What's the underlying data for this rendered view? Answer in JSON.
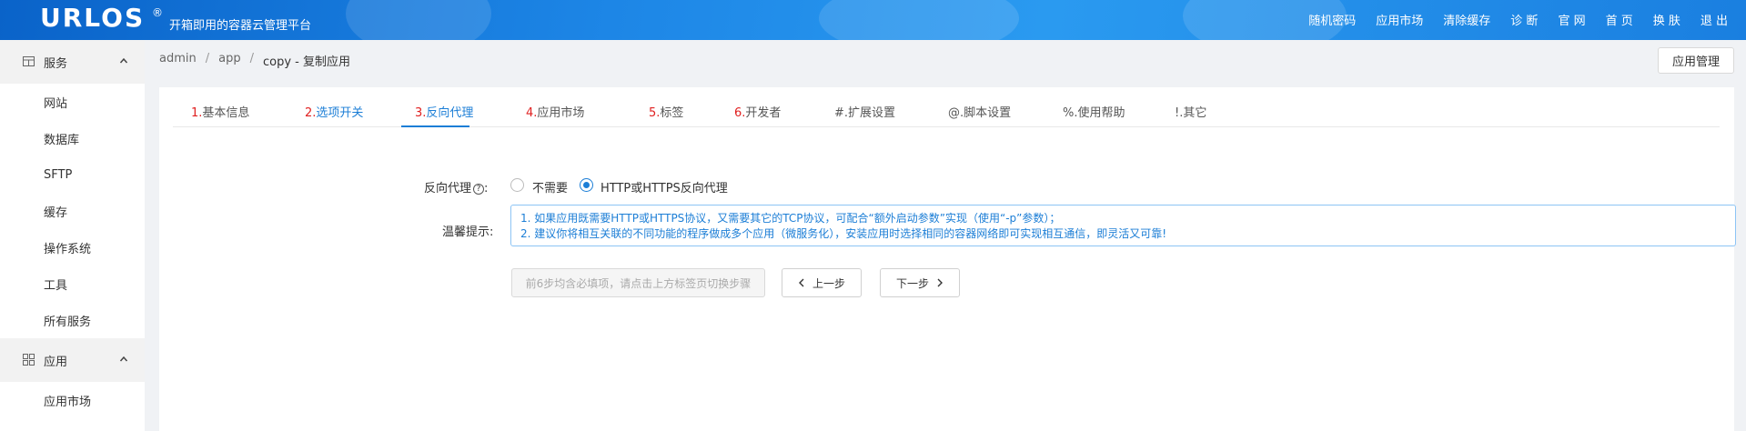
{
  "header": {
    "logo": "URLOS",
    "reg": "®",
    "slogan": "开箱即用的容器云管理平台",
    "nav": [
      "随机密码",
      "应用市场",
      "清除缓存",
      "诊 断",
      "官 网",
      "首 页",
      "换 肤",
      "退 出"
    ]
  },
  "sidebar": {
    "group1": "服务",
    "items1": [
      "网站",
      "数据库",
      "SFTP",
      "缓存",
      "操作系统",
      "工具",
      "所有服务"
    ],
    "group2": "应用",
    "items2": [
      "应用市场"
    ]
  },
  "breadcrumb": [
    "admin",
    "app",
    "copy - 复制应用"
  ],
  "app_manage_button": "应用管理",
  "tabs": [
    {
      "num": "1.",
      "label": "基本信息"
    },
    {
      "num": "2.",
      "label": "选项开关"
    },
    {
      "num": "3.",
      "label": "反向代理"
    },
    {
      "num": "4.",
      "label": "应用市场"
    },
    {
      "num": "5.",
      "label": "标签"
    },
    {
      "num": "6.",
      "label": "开发者"
    },
    {
      "num": "#.",
      "label": "扩展设置"
    },
    {
      "num": "@.",
      "label": "脚本设置"
    },
    {
      "num": "%.",
      "label": "使用帮助"
    },
    {
      "num": "!.",
      "label": "其它"
    }
  ],
  "form": {
    "proxy_label": "反向代理",
    "help_glyph": "?",
    "colon": ":",
    "option_none": "不需要",
    "option_http": "HTTP或HTTPS反向代理",
    "tip_label": "温馨提示",
    "tip_line1": "1. 如果应用既需要HTTP或HTTPS协议，又需要其它的TCP协议，可配合“额外启动参数”实现（使用“-p”参数）；",
    "tip_line2": "2. 建议你将相互关联的不同功能的程序做成多个应用（微服务化），安装应用时选择相同的容器网络即可实现相互通信，即灵活又可靠!"
  },
  "buttons": {
    "hint": "前6步均含必填项，请点击上方标签页切换步骤",
    "prev": "上一步",
    "next": "下一步"
  }
}
